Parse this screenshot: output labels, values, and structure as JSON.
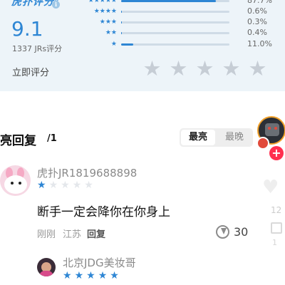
{
  "rating": {
    "brand": "虎扑评分",
    "brand_mark": "®",
    "info_icon": "i",
    "score": "9.1",
    "count_text": "1337 JRs评分",
    "distribution": [
      {
        "stars": "★★★★★",
        "pct_text": "87.7%",
        "pct": 87.7
      },
      {
        "stars": "★★★★",
        "pct_text": "0.6%",
        "pct": 0.6
      },
      {
        "stars": "★★★",
        "pct_text": "0.3%",
        "pct": 0.3
      },
      {
        "stars": "★★",
        "pct_text": "0.4%",
        "pct": 0.4
      },
      {
        "stars": "★",
        "pct_text": "11.0%",
        "pct": 11.0
      }
    ],
    "rate_label": "立即评分",
    "rate_star_glyph": "★",
    "accent_color": "#2e86d4"
  },
  "comments": {
    "title": "亮回复",
    "page": "/1",
    "sort": {
      "hot": "最亮",
      "new": "最晚",
      "selected": "hot"
    },
    "items": [
      {
        "username": "虎扑JR1819688898",
        "user_rating": 1,
        "text": "断手一定会降你在你身上",
        "time": "刚刚",
        "location": "江苏",
        "reply_label": "回复",
        "likes": "30"
      },
      {
        "username": "北京JDG美妆哥",
        "user_rating": 5
      }
    ]
  },
  "overlay": {
    "follow_plus": "+",
    "like_count": "12",
    "fav_count": "1",
    "heart_glyph": "♥"
  }
}
